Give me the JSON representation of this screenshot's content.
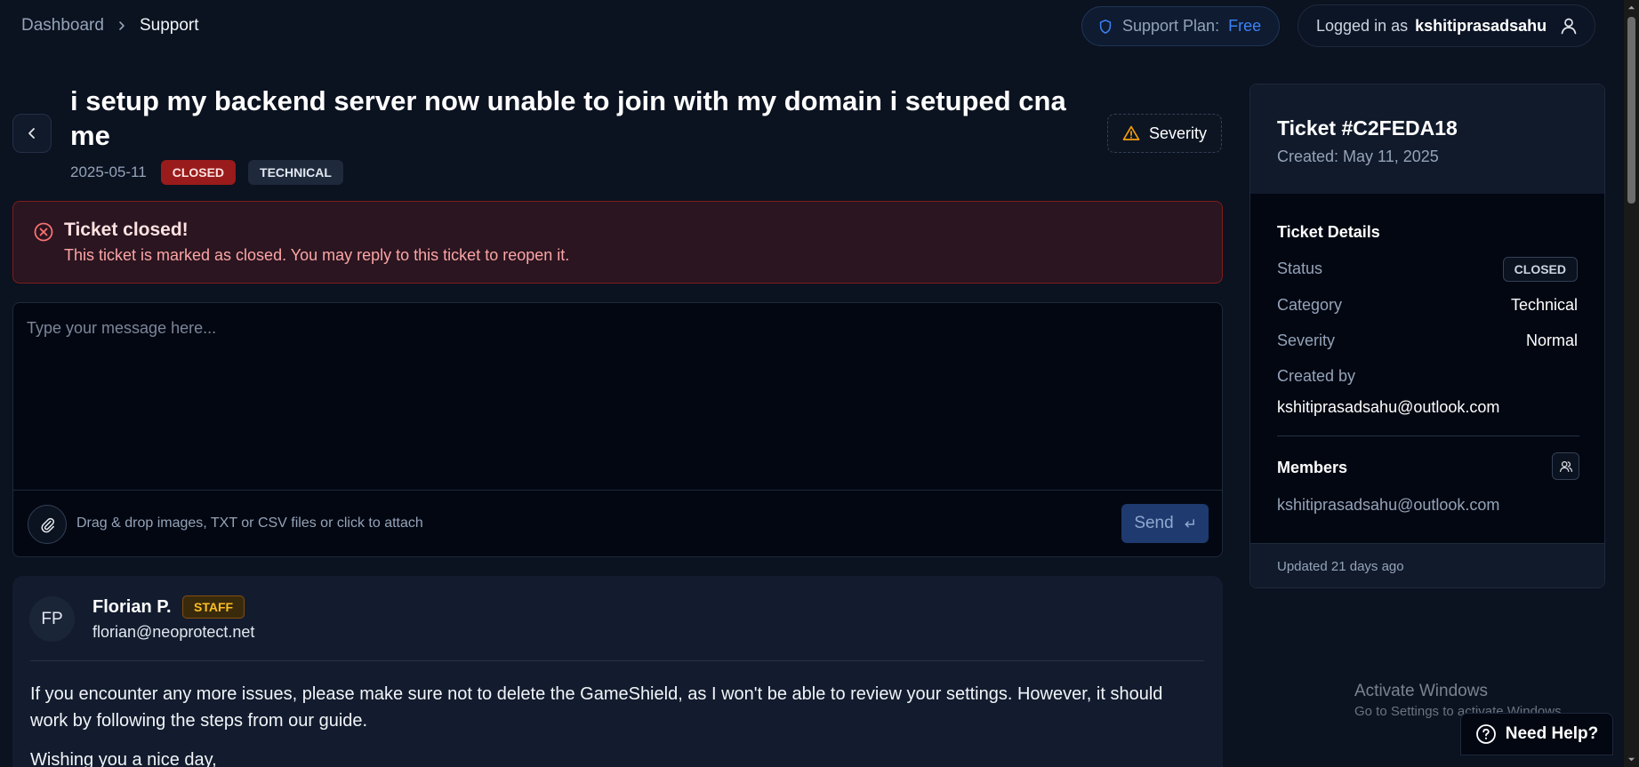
{
  "breadcrumb": {
    "parent": "Dashboard",
    "current": "Support"
  },
  "support_plan": {
    "label": "Support Plan:",
    "value": "Free"
  },
  "user": {
    "prefix": "Logged in as",
    "username": "kshitiprasadsahu"
  },
  "ticket": {
    "title": "i setup my backend server now unable to join with my domain i setuped cname",
    "date": "2025-05-11",
    "status_badge": "CLOSED",
    "category_badge": "TECHNICAL",
    "severity_button": "Severity"
  },
  "alert": {
    "title": "Ticket closed!",
    "text": "This ticket is marked as closed. You may reply to this ticket to reopen it."
  },
  "composer": {
    "placeholder": "Type your message here...",
    "attach_text": "Drag & drop images, TXT or CSV files or click to attach",
    "send_label": "Send"
  },
  "message": {
    "initials": "FP",
    "author": "Florian P.",
    "role_badge": "STAFF",
    "email": "florian@neoprotect.net",
    "paragraphs": [
      "If you encounter any more issues, please make sure not to delete the GameShield, as I won't be able to review your settings. However, it should work by following the steps from our guide.",
      "Wishing you a nice day,"
    ]
  },
  "panel": {
    "ticket_id": "Ticket #C2FEDA18",
    "created": "Created: May 11, 2025",
    "details_heading": "Ticket Details",
    "status_label": "Status",
    "status_value": "CLOSED",
    "category_label": "Category",
    "category_value": "Technical",
    "severity_label": "Severity",
    "severity_value": "Normal",
    "created_by_label": "Created by",
    "created_by_value": "kshitiprasadsahu@outlook.com",
    "members_heading": "Members",
    "member": "kshitiprasadsahu@outlook.com",
    "updated": "Updated 21 days ago"
  },
  "watermark": {
    "title": "Activate Windows",
    "subtitle": "Go to Settings to activate Windows."
  },
  "help_button": "Need Help?",
  "colors": {
    "background": "#0b1220",
    "accent_blue": "#3b82f6",
    "closed_red": "#991b1b",
    "staff_amber": "#fbbf24",
    "warning_amber": "#f59e0b"
  },
  "icons": [
    "chevron-right-icon",
    "shield-icon",
    "user-icon",
    "chevron-left-icon",
    "warning-icon",
    "close-circle-icon",
    "paperclip-icon",
    "enter-icon",
    "members-icon",
    "help-circle-icon"
  ]
}
